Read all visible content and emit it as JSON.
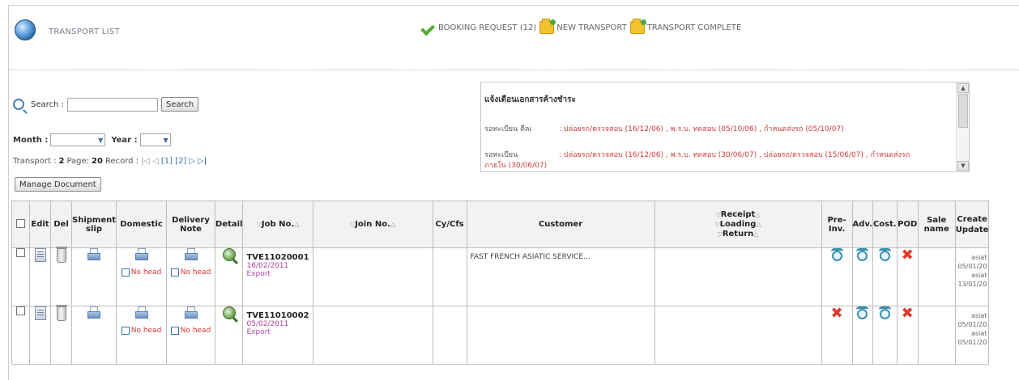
{
  "header": {
    "title": "TRANSPORT LIST",
    "links": [
      {
        "label": "BOOKING REQUEST (12)",
        "icon": "green-check-icon"
      },
      {
        "label": "NEW TRANSPORT",
        "icon": "folder-new-icon"
      },
      {
        "label": "TRANSPORT COMPLETE",
        "icon": "folder-complete-icon"
      }
    ]
  },
  "search": {
    "label": "Search :",
    "value": "",
    "button": "Search",
    "month_label": "Month :",
    "year_label": "Year :",
    "month_value": "",
    "year_value": ""
  },
  "paging": {
    "transport_label": "Transport :",
    "transport_count": "2",
    "pages_label": "Page:",
    "pages_count": "20",
    "record_label": "Record :",
    "first": "|◁",
    "prev": "◁",
    "pages": "[1] [2]",
    "next": "▷",
    "last": "▷|"
  },
  "manage_button": "Manage Document",
  "notice": {
    "title": "แจ้งเตือนเอกสารค้างชำระ",
    "rows": [
      {
        "key": "รอทะเบียน ดีลเ",
        "value": ": ปล่อยรถ/ตรวจสอบ (16/12/06) , พ.ร.บ. ทดสอบ (05/10/06) , กำหนดส่งรถ (05/10/07)"
      },
      {
        "key": "รอทะเบียน",
        "value": ": ปล่อยรถ/ตรวจสอบ (16/12/06) , พ.ร.บ. ทดสอบ (30/06/07) , ปล่อยรถ/ตรวจสอบ (15/06/07) , กำหนดส่งรถ"
      },
      {
        "key": "",
        "value": "ภายใน (30/06/07)"
      }
    ]
  },
  "table": {
    "headers": {
      "edit": "Edit",
      "del": "Del",
      "shipment": "Shipment slip",
      "domestic": "Domestic",
      "delivery": "Delivery Note",
      "detail": "Detail",
      "job": "Job No.",
      "join": "Join No.",
      "cy": "Cy/Cfs",
      "customer": "Customer",
      "receipt": "Receipt",
      "loading": "Loading",
      "return": "Return",
      "preinv": "Pre-Inv.",
      "adv": "Adv.",
      "cost": "Cost.",
      "pod": "POD",
      "sale": "Sale name",
      "create": "Create",
      "update": "Update"
    },
    "nohead_label": "No head",
    "rows": [
      {
        "job_no": "TVE11020001",
        "job_date": "16/02/2011",
        "job_type": "Export",
        "customer": "FAST FRENCH ASIATIC SERVICE...",
        "preinv": "clock",
        "adv": "clock",
        "cost": "clock",
        "pod": "x",
        "create_by": "asiat",
        "create_date": "05/01/20",
        "update_by": "asiat",
        "update_date": "13/01/20"
      },
      {
        "job_no": "TVE11010002",
        "job_date": "05/02/2011",
        "job_type": "Export",
        "customer": "",
        "preinv": "x",
        "adv": "clock",
        "cost": "clock",
        "pod": "x",
        "create_by": "asiat",
        "create_date": "05/01/20",
        "update_by": "asiat",
        "update_date": "05/01/20"
      }
    ]
  }
}
